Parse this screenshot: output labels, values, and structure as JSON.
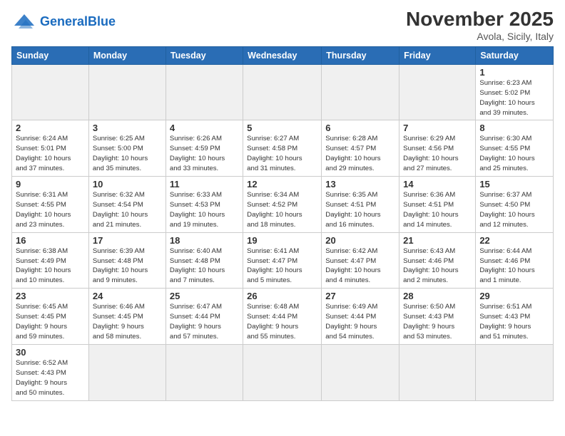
{
  "header": {
    "logo_general": "General",
    "logo_blue": "Blue",
    "month_title": "November 2025",
    "location": "Avola, Sicily, Italy"
  },
  "columns": [
    "Sunday",
    "Monday",
    "Tuesday",
    "Wednesday",
    "Thursday",
    "Friday",
    "Saturday"
  ],
  "weeks": [
    [
      {
        "day": "",
        "info": ""
      },
      {
        "day": "",
        "info": ""
      },
      {
        "day": "",
        "info": ""
      },
      {
        "day": "",
        "info": ""
      },
      {
        "day": "",
        "info": ""
      },
      {
        "day": "",
        "info": ""
      },
      {
        "day": "1",
        "info": "Sunrise: 6:23 AM\nSunset: 5:02 PM\nDaylight: 10 hours\nand 39 minutes."
      }
    ],
    [
      {
        "day": "2",
        "info": "Sunrise: 6:24 AM\nSunset: 5:01 PM\nDaylight: 10 hours\nand 37 minutes."
      },
      {
        "day": "3",
        "info": "Sunrise: 6:25 AM\nSunset: 5:00 PM\nDaylight: 10 hours\nand 35 minutes."
      },
      {
        "day": "4",
        "info": "Sunrise: 6:26 AM\nSunset: 4:59 PM\nDaylight: 10 hours\nand 33 minutes."
      },
      {
        "day": "5",
        "info": "Sunrise: 6:27 AM\nSunset: 4:58 PM\nDaylight: 10 hours\nand 31 minutes."
      },
      {
        "day": "6",
        "info": "Sunrise: 6:28 AM\nSunset: 4:57 PM\nDaylight: 10 hours\nand 29 minutes."
      },
      {
        "day": "7",
        "info": "Sunrise: 6:29 AM\nSunset: 4:56 PM\nDaylight: 10 hours\nand 27 minutes."
      },
      {
        "day": "8",
        "info": "Sunrise: 6:30 AM\nSunset: 4:55 PM\nDaylight: 10 hours\nand 25 minutes."
      }
    ],
    [
      {
        "day": "9",
        "info": "Sunrise: 6:31 AM\nSunset: 4:55 PM\nDaylight: 10 hours\nand 23 minutes."
      },
      {
        "day": "10",
        "info": "Sunrise: 6:32 AM\nSunset: 4:54 PM\nDaylight: 10 hours\nand 21 minutes."
      },
      {
        "day": "11",
        "info": "Sunrise: 6:33 AM\nSunset: 4:53 PM\nDaylight: 10 hours\nand 19 minutes."
      },
      {
        "day": "12",
        "info": "Sunrise: 6:34 AM\nSunset: 4:52 PM\nDaylight: 10 hours\nand 18 minutes."
      },
      {
        "day": "13",
        "info": "Sunrise: 6:35 AM\nSunset: 4:51 PM\nDaylight: 10 hours\nand 16 minutes."
      },
      {
        "day": "14",
        "info": "Sunrise: 6:36 AM\nSunset: 4:51 PM\nDaylight: 10 hours\nand 14 minutes."
      },
      {
        "day": "15",
        "info": "Sunrise: 6:37 AM\nSunset: 4:50 PM\nDaylight: 10 hours\nand 12 minutes."
      }
    ],
    [
      {
        "day": "16",
        "info": "Sunrise: 6:38 AM\nSunset: 4:49 PM\nDaylight: 10 hours\nand 10 minutes."
      },
      {
        "day": "17",
        "info": "Sunrise: 6:39 AM\nSunset: 4:48 PM\nDaylight: 10 hours\nand 9 minutes."
      },
      {
        "day": "18",
        "info": "Sunrise: 6:40 AM\nSunset: 4:48 PM\nDaylight: 10 hours\nand 7 minutes."
      },
      {
        "day": "19",
        "info": "Sunrise: 6:41 AM\nSunset: 4:47 PM\nDaylight: 10 hours\nand 5 minutes."
      },
      {
        "day": "20",
        "info": "Sunrise: 6:42 AM\nSunset: 4:47 PM\nDaylight: 10 hours\nand 4 minutes."
      },
      {
        "day": "21",
        "info": "Sunrise: 6:43 AM\nSunset: 4:46 PM\nDaylight: 10 hours\nand 2 minutes."
      },
      {
        "day": "22",
        "info": "Sunrise: 6:44 AM\nSunset: 4:46 PM\nDaylight: 10 hours\nand 1 minute."
      }
    ],
    [
      {
        "day": "23",
        "info": "Sunrise: 6:45 AM\nSunset: 4:45 PM\nDaylight: 9 hours\nand 59 minutes."
      },
      {
        "day": "24",
        "info": "Sunrise: 6:46 AM\nSunset: 4:45 PM\nDaylight: 9 hours\nand 58 minutes."
      },
      {
        "day": "25",
        "info": "Sunrise: 6:47 AM\nSunset: 4:44 PM\nDaylight: 9 hours\nand 57 minutes."
      },
      {
        "day": "26",
        "info": "Sunrise: 6:48 AM\nSunset: 4:44 PM\nDaylight: 9 hours\nand 55 minutes."
      },
      {
        "day": "27",
        "info": "Sunrise: 6:49 AM\nSunset: 4:44 PM\nDaylight: 9 hours\nand 54 minutes."
      },
      {
        "day": "28",
        "info": "Sunrise: 6:50 AM\nSunset: 4:43 PM\nDaylight: 9 hours\nand 53 minutes."
      },
      {
        "day": "29",
        "info": "Sunrise: 6:51 AM\nSunset: 4:43 PM\nDaylight: 9 hours\nand 51 minutes."
      }
    ],
    [
      {
        "day": "30",
        "info": "Sunrise: 6:52 AM\nSunset: 4:43 PM\nDaylight: 9 hours\nand 50 minutes."
      },
      {
        "day": "",
        "info": ""
      },
      {
        "day": "",
        "info": ""
      },
      {
        "day": "",
        "info": ""
      },
      {
        "day": "",
        "info": ""
      },
      {
        "day": "",
        "info": ""
      },
      {
        "day": "",
        "info": ""
      }
    ]
  ]
}
